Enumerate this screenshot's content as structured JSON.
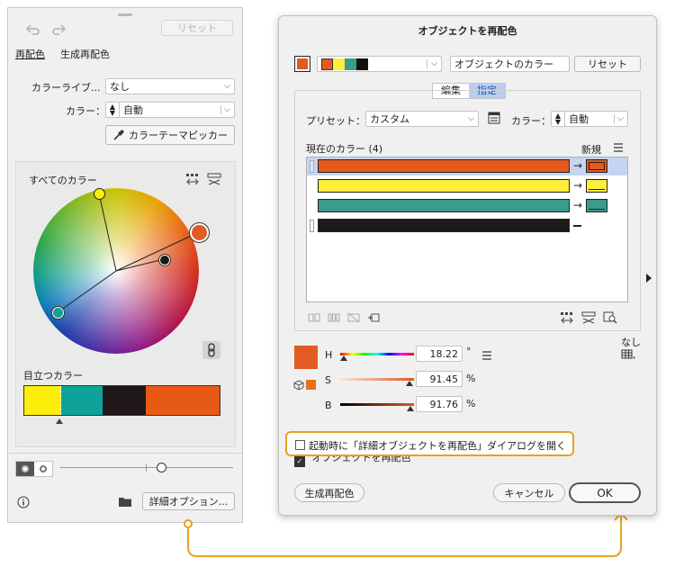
{
  "left_panel": {
    "reset_label": "リセット",
    "tab_recolor": "再配色",
    "tab_generative": "生成再配色",
    "library_label": "カラーライブ...",
    "library_value": "なし",
    "color_label": "カラー：",
    "color_value": "自動",
    "picker_label": "カラーテーマピッカー",
    "all_colors_label": "すべてのカラー",
    "prominent_label": "目立つカラー",
    "prominent_colors": [
      "#fcee0a",
      "#0ea39a",
      "#201818",
      "#e85a14"
    ],
    "more_options_label": "詳細オプション..."
  },
  "dialog": {
    "title": "オブジェクトを再配色",
    "object_colors_label": "オブジェクトのカラー",
    "reset_label": "リセット",
    "tab_edit": "編集",
    "tab_assign": "指定",
    "preset_label": "プリセット：",
    "preset_value": "カスタム",
    "color_label": "カラー：",
    "color_value": "自動",
    "current_colors_label": "現在のカラー (4)",
    "new_label": "新規",
    "current_colors": [
      "#e45a1e",
      "#fdee3c",
      "#3a9a8e",
      "#1e1a18"
    ],
    "h_label": "H",
    "h_value": "18.22",
    "h_unit": "°",
    "s_label": "S",
    "s_value": "91.45",
    "s_unit": "%",
    "b_label": "B",
    "b_value": "91.76",
    "b_unit": "%",
    "none_label": "なし",
    "startup_label": "起動時に「詳細オブジェクトを再配色」ダイアログを開く",
    "recolor_checkbox_label": "オブジェクトを再配色",
    "generative_button": "生成再配色",
    "cancel_label": "キャンセル",
    "ok_label": "OK",
    "accent": "#e8a020",
    "selected_color": "#e25b22"
  }
}
